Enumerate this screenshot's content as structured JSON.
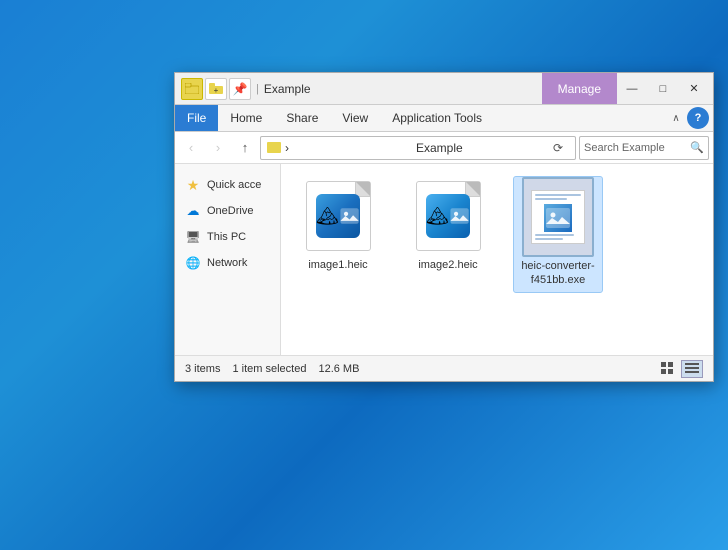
{
  "desktop": {
    "background": "blue gradient"
  },
  "titlebar": {
    "title": "Example",
    "manage_label": "Manage",
    "minimize_label": "—",
    "maximize_label": "□",
    "close_label": "✕"
  },
  "menu": {
    "file_label": "File",
    "home_label": "Home",
    "share_label": "Share",
    "view_label": "View",
    "app_tools_label": "Application Tools",
    "collapse_label": "∧",
    "help_label": "?"
  },
  "navbar": {
    "back_label": "‹",
    "forward_label": "›",
    "up_label": "↑",
    "address": "Example",
    "refresh_label": "⟳",
    "search_placeholder": "Search Example",
    "search_icon": "🔍"
  },
  "sidebar": {
    "items": [
      {
        "id": "quick-access",
        "label": "Quick acce",
        "icon": "★"
      },
      {
        "id": "onedrive",
        "label": "OneDrive",
        "icon": "☁"
      },
      {
        "id": "this-pc",
        "label": "This PC",
        "icon": "🖥"
      },
      {
        "id": "network",
        "label": "Network",
        "icon": "🌐"
      }
    ]
  },
  "files": [
    {
      "id": "image1",
      "name": "image1.heic",
      "type": "heic",
      "selected": false
    },
    {
      "id": "image2",
      "name": "image2.heic",
      "type": "heic",
      "selected": false
    },
    {
      "id": "converter",
      "name": "heic-converter-f451bb.exe",
      "type": "exe",
      "selected": true
    }
  ],
  "statusbar": {
    "item_count": "3 items",
    "selection_info": "1 item selected",
    "size": "12.6 MB"
  }
}
